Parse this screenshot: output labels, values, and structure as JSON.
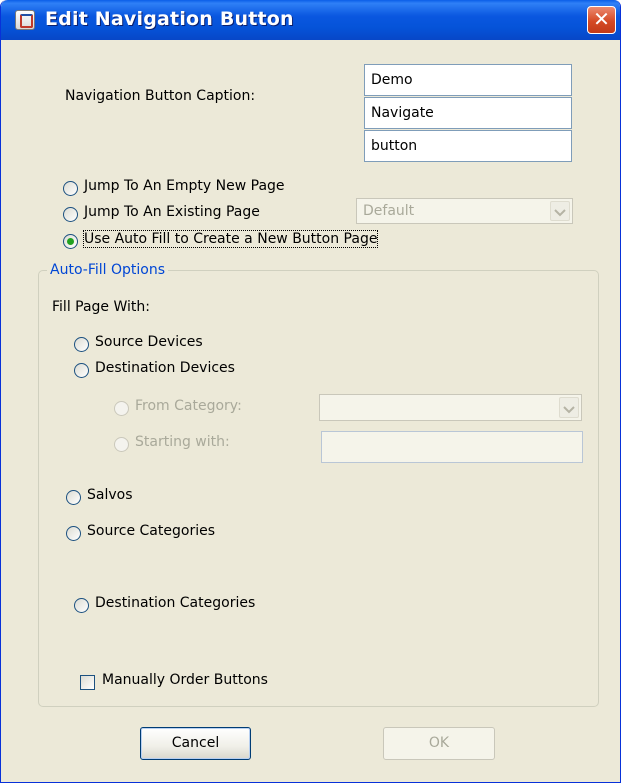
{
  "window": {
    "title": "Edit Navigation Button",
    "close_glyph": "✕"
  },
  "caption": {
    "label": "Navigation Button Caption:",
    "lines": [
      "Demo",
      "Navigate",
      "button"
    ]
  },
  "navigation": {
    "options": [
      {
        "label": "Jump To An Empty New Page",
        "selected": false
      },
      {
        "label": "Jump To An Existing Page",
        "selected": false
      },
      {
        "label": "Use Auto Fill to Create a New Button Page",
        "selected": true
      }
    ],
    "existing_page_select": "Default"
  },
  "autofill": {
    "legend": "Auto-Fill Options",
    "fill_label": "Fill Page With:",
    "source_devices": "Source Devices",
    "destination_devices": "Destination Devices",
    "from_category": "From Category:",
    "starting_with": "Starting with:",
    "salvos": "Salvos",
    "source_categories": "Source Categories",
    "destination_categories": "Destination Categories",
    "manually_order": "Manually Order Buttons"
  },
  "buttons": {
    "cancel": "Cancel",
    "ok": "OK"
  },
  "icons": {
    "window_icon": "java-cup-icon",
    "close": "close-icon",
    "dropdown": "chevron-down-icon"
  },
  "colors": {
    "titlebar": "#0a57e0",
    "dialog_bg": "#ece9d8",
    "legend_text": "#0046d5",
    "close_button": "#d54a25"
  }
}
